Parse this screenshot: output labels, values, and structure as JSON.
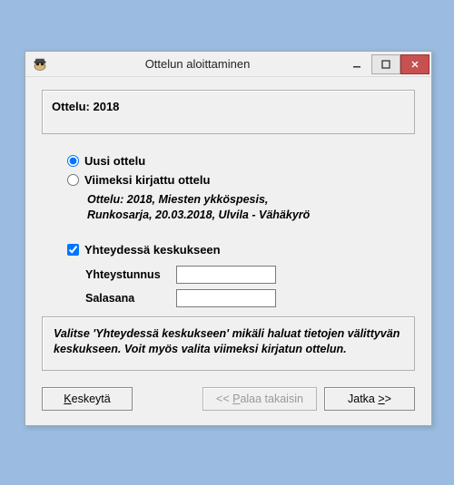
{
  "window": {
    "title": "Ottelun aloittaminen"
  },
  "ottelu_box": {
    "label": "Ottelu: 2018"
  },
  "radio": {
    "new_match": "Uusi ottelu",
    "last_match": "Viimeksi kirjattu ottelu",
    "selected": "new_match",
    "last_match_details": "Ottelu: 2018, Miesten ykköspesis, Runkosarja, 20.03.2018, Ulvila - Vähäkyrö"
  },
  "connection": {
    "label": "Yhteydessä keskukseen",
    "checked": true,
    "id_label": "Yhteystunnus",
    "pw_label": "Salasana",
    "id_value": "",
    "pw_value": ""
  },
  "info_text": "Valitse 'Yhteydessä keskukseen' mikäli haluat tietojen välittyvän keskukseen. Voit myös valita viimeksi kirjatun ottelun.",
  "buttons": {
    "cancel_prefix": "K",
    "cancel_rest": "eskeytä",
    "back_prefix": "<< ",
    "back_underline": "P",
    "back_rest": "alaa takaisin",
    "next_prefix": "Jatka ",
    "next_underline": ">",
    "next_rest": ">"
  }
}
